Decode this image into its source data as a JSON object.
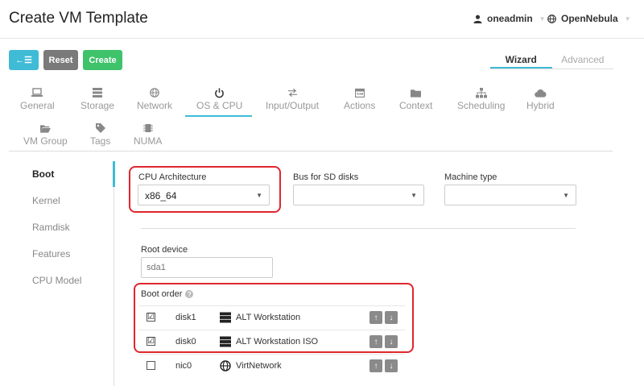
{
  "header": {
    "title": "Create VM Template",
    "user": "oneadmin",
    "zone": "OpenNebula"
  },
  "toolbar": {
    "back_glyph": "←☰",
    "reset_label": "Reset",
    "create_label": "Create"
  },
  "mode_tabs": {
    "wizard": "Wizard",
    "advanced": "Advanced"
  },
  "tabs": [
    {
      "label": "General",
      "icon": "laptop-icon"
    },
    {
      "label": "Storage",
      "icon": "database-icon"
    },
    {
      "label": "Network",
      "icon": "globe-icon"
    },
    {
      "label": "OS & CPU",
      "icon": "power-icon"
    },
    {
      "label": "Input/Output",
      "icon": "exchange-icon"
    },
    {
      "label": "Actions",
      "icon": "calendar-icon"
    },
    {
      "label": "Context",
      "icon": "folder-icon"
    },
    {
      "label": "Scheduling",
      "icon": "sitemap-icon"
    },
    {
      "label": "Hybrid",
      "icon": "cloud-icon"
    },
    {
      "label": "VM Group",
      "icon": "folder-open-icon"
    },
    {
      "label": "Tags",
      "icon": "tag-icon"
    },
    {
      "label": "NUMA",
      "icon": "chip-icon"
    }
  ],
  "sidenav": {
    "items": [
      "Boot",
      "Kernel",
      "Ramdisk",
      "Features",
      "CPU Model"
    ]
  },
  "fields": {
    "cpu_arch_label": "CPU Architecture",
    "cpu_arch_value": "x86_64",
    "bus_label": "Bus for SD disks",
    "bus_value": "",
    "machine_label": "Machine type",
    "machine_value": "",
    "root_device_label": "Root device",
    "root_device_placeholder": "sda1"
  },
  "boot_order": {
    "label": "Boot order",
    "help": "?",
    "rows": [
      {
        "checked": "☑",
        "device": "disk1",
        "name": "ALT Workstation",
        "type": "disk"
      },
      {
        "checked": "☑",
        "device": "disk0",
        "name": "ALT Workstation ISO",
        "type": "disk"
      },
      {
        "checked": "",
        "device": "nic0",
        "name": "VirtNetwork",
        "type": "network"
      }
    ],
    "up_glyph": "↑",
    "down_glyph": "↓"
  },
  "colors": {
    "accent": "#3fbbd6",
    "create": "#3ec26a",
    "reset": "#7a7a7a",
    "highlight": "#e0262e"
  }
}
